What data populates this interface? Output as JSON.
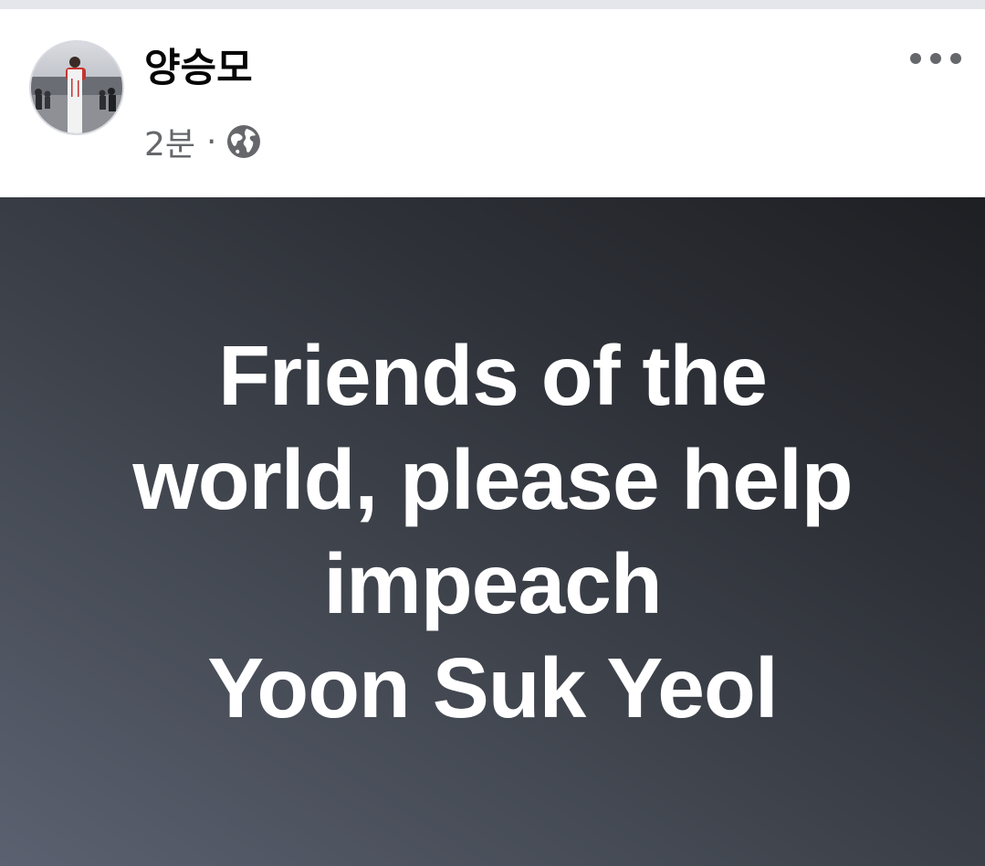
{
  "post": {
    "author": {
      "name": "양승모",
      "avatar_icon": "profile-photo"
    },
    "timestamp": "2분",
    "separator": "·",
    "privacy_icon": "globe-icon",
    "more_icon": "more-options-icon",
    "content": {
      "lines": [
        "Friends of the",
        "world, please help",
        "impeach",
        "Yoon Suk Yeol"
      ],
      "text_color": "#ffffff",
      "background_colors": [
        "#5b6170",
        "#2e3138",
        "#1e1f23"
      ]
    }
  },
  "colors": {
    "name_text": "#050505",
    "meta_text": "#65676b",
    "divider": "#e4e6eb"
  }
}
